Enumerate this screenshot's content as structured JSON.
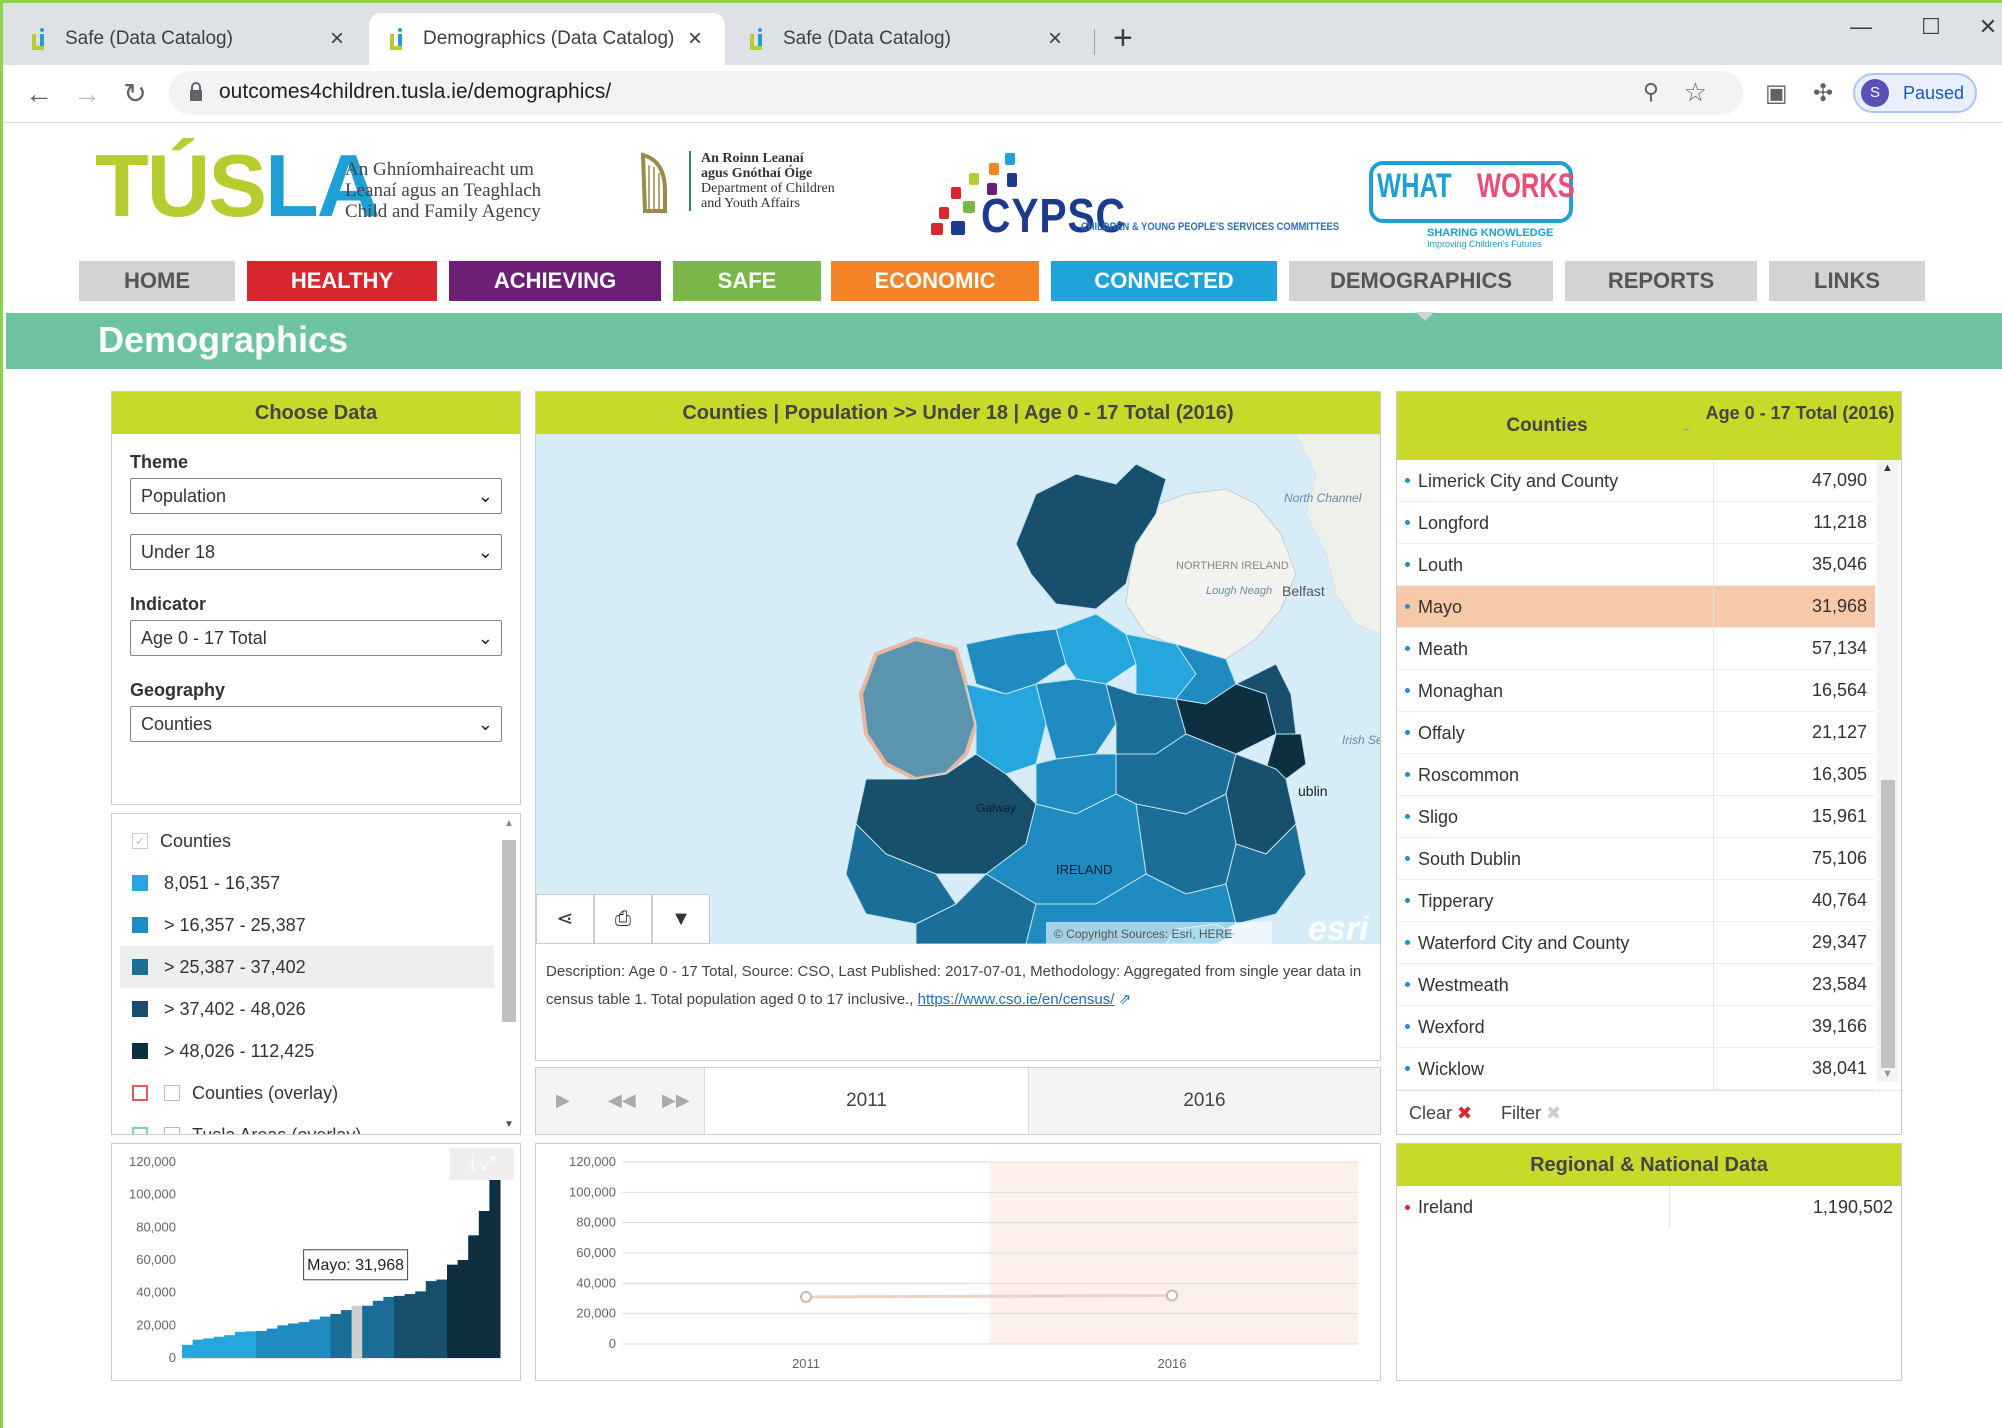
{
  "browser": {
    "tabs": [
      {
        "title": "Safe (Data Catalog)"
      },
      {
        "title": "Demographics (Data Catalog)"
      },
      {
        "title": "Safe (Data Catalog)"
      }
    ],
    "url": "outcomes4children.tusla.ie/demographics/",
    "profile_initial": "S",
    "profile_status": "Paused"
  },
  "header": {
    "tusla_word": "TUSLA",
    "tusla_sub": [
      "An Ghníomhaireacht um",
      "Leanaí agus an Teaghlach",
      "Child and Family Agency"
    ],
    "dept": [
      "An Roinn Leanaí",
      "agus Gnóthaí Óige",
      "Department of Children",
      "and Youth Affairs"
    ],
    "cypsc": "CYPSC",
    "cypsc_tag": "CHILDREN & YOUNG PEOPLE'S SERVICES COMMITTEES",
    "whatworks_1": "WHAT",
    "whatworks_2": "WORKS",
    "whatworks_sub1": "SHARING KNOWLEDGE",
    "whatworks_sub2": "Improving Children's Futures"
  },
  "nav": [
    {
      "label": "HOME",
      "color": "#d3d3d3"
    },
    {
      "label": "HEALTHY",
      "color": "#d7262d"
    },
    {
      "label": "ACHIEVING",
      "color": "#6b2075"
    },
    {
      "label": "SAFE",
      "color": "#7ab648"
    },
    {
      "label": "ECONOMIC",
      "color": "#f58426"
    },
    {
      "label": "CONNECTED",
      "color": "#1ea4d9"
    },
    {
      "label": "DEMOGRAPHICS",
      "color": "#d3d3d3"
    },
    {
      "label": "REPORTS",
      "color": "#d3d3d3"
    },
    {
      "label": "LINKS",
      "color": "#d3d3d3"
    }
  ],
  "page_title": "Demographics",
  "choose": {
    "title": "Choose Data",
    "theme_label": "Theme",
    "theme": "Population",
    "subtheme": "Under 18",
    "indicator_label": "Indicator",
    "indicator": "Age 0 - 17 Total",
    "geography_label": "Geography",
    "geography": "Counties"
  },
  "legend": {
    "header": "Counties",
    "classes": [
      {
        "label": "8,051 - 16,357",
        "color": "#25a7dd"
      },
      {
        "label": "> 16,357 - 25,387",
        "color": "#1e8cc0"
      },
      {
        "label": "> 25,387 - 37,402",
        "color": "#1a6e98"
      },
      {
        "label": "> 37,402 - 48,026",
        "color": "#174f6c"
      },
      {
        "label": "> 48,026 - 112,425",
        "color": "#0e2f40"
      }
    ],
    "overlay1": "Counties (overlay)",
    "overlay2": "Tusla Areas (overlay)"
  },
  "map": {
    "title": "Counties | Population >> Under 18 | Age 0 - 17 Total (2016)",
    "labels": {
      "north_channel": "North Channel",
      "ni": "NORTHERN IRELAND",
      "lough": "Lough Neagh",
      "belfast": "Belfast",
      "irish_sea": "Irish Sea",
      "dublin": "ublin",
      "galway": "Galway",
      "ireland": "IRELAND"
    },
    "attribution": "© Copyright Sources: Esri, HERE",
    "esri": "esri",
    "description": "Description: Age 0 - 17 Total, Source: CSO, Last Published: 2017-07-01, Methodology: Aggregated from single year data in census table 1. Total population aged 0 to 17 inclusive.,",
    "link": "https://www.cso.ie/en/census/"
  },
  "time": {
    "years": [
      "2011",
      "2016"
    ]
  },
  "table": {
    "col1": "Counties",
    "col2": "Age 0 - 17 Total (2016)",
    "rows": [
      {
        "name": "Limerick City and County",
        "value": "47,090"
      },
      {
        "name": "Longford",
        "value": "11,218"
      },
      {
        "name": "Louth",
        "value": "35,046"
      },
      {
        "name": "Mayo",
        "value": "31,968",
        "hl": true
      },
      {
        "name": "Meath",
        "value": "57,134"
      },
      {
        "name": "Monaghan",
        "value": "16,564"
      },
      {
        "name": "Offaly",
        "value": "21,127"
      },
      {
        "name": "Roscommon",
        "value": "16,305"
      },
      {
        "name": "Sligo",
        "value": "15,961"
      },
      {
        "name": "South Dublin",
        "value": "75,106"
      },
      {
        "name": "Tipperary",
        "value": "40,764"
      },
      {
        "name": "Waterford City and County",
        "value": "29,347"
      },
      {
        "name": "Westmeath",
        "value": "23,584"
      },
      {
        "name": "Wexford",
        "value": "39,166"
      },
      {
        "name": "Wicklow",
        "value": "38,041"
      }
    ],
    "clear": "Clear",
    "filter": "Filter"
  },
  "regional": {
    "title": "Regional & National Data",
    "rows": [
      {
        "name": "Ireland",
        "value": "1,190,502"
      }
    ]
  },
  "chart_data": [
    {
      "type": "bar",
      "title": "",
      "ylim": [
        0,
        120000
      ],
      "yticks": [
        "0",
        "20,000",
        "40,000",
        "60,000",
        "80,000",
        "100,000",
        "120,000"
      ],
      "values": [
        8051,
        11218,
        12000,
        13000,
        14000,
        15961,
        16305,
        16564,
        18000,
        20000,
        21127,
        22000,
        23584,
        25387,
        27000,
        29347,
        31968,
        32000,
        35046,
        37402,
        38041,
        39166,
        40764,
        47090,
        48026,
        57134,
        60000,
        75106,
        90000,
        112425
      ],
      "highlight": {
        "label": "Mayo: 31,968",
        "value": 31968
      }
    },
    {
      "type": "line",
      "title": "",
      "x": [
        "2011",
        "2016"
      ],
      "series": [
        {
          "values": [
            31000,
            31968
          ]
        }
      ],
      "ylim": [
        0,
        120000
      ],
      "yticks": [
        "0",
        "20,000",
        "40,000",
        "60,000",
        "80,000",
        "100,000",
        "120,000"
      ]
    }
  ]
}
